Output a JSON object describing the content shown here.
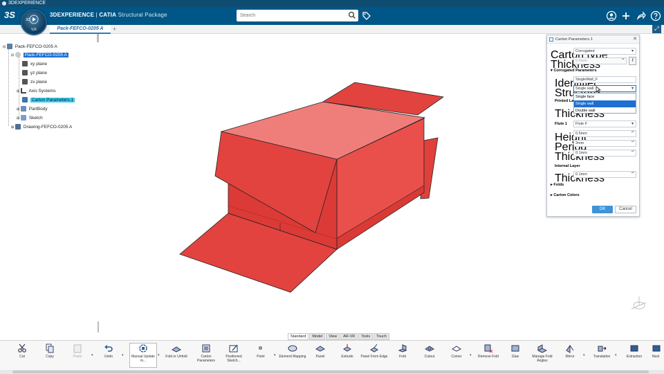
{
  "os": {
    "title": "3DEXPERIENCE"
  },
  "header": {
    "brand": "3DEXPERIENCE",
    "app": "CATIA",
    "app_sub": "Structural Package",
    "compass_version": "V,R",
    "search_placeholder": "Search",
    "accent": "#005686"
  },
  "tabs": {
    "document": "Pack-FEFCO-0205 A",
    "add": "+"
  },
  "tree": {
    "root": "Pack-FEFCO-0205 A",
    "product": "Pack-FEFCO-0205 A",
    "items": [
      "xy plane",
      "yz plane",
      "zx plane",
      "Axis Systems",
      "Carton Parameters.1",
      "PartBody",
      "Sketch"
    ],
    "drawing": "Drawing-FEFCO-0205 A"
  },
  "dialog": {
    "title": "Carton Parameters.1",
    "carton_type_label": "Carton type",
    "carton_type_value": "Corrugated",
    "thickness_label": "Thickness",
    "thickness_value": "0.4mm",
    "corrugated_section": "Corrugated Parameters",
    "identifier_label": "Identifier",
    "identifier_value": "SingleWall_F",
    "structure_label": "Structure",
    "structure_value": "Single wall",
    "structure_options": [
      "Single face",
      "Single wall",
      "Double wall"
    ],
    "printed_label": "Printed La",
    "printed_thickness_label": "Thickness",
    "flute_label": "Flute 1",
    "flute_value": "Flute F",
    "height_label": "Height",
    "height_value": "0.5mm",
    "period_label": "Period",
    "period_value": "2mm",
    "flute_thickness_label": "Thickness",
    "flute_thickness_value": "0.1mm",
    "internal_section": "Internal Layer",
    "internal_thickness_label": "Thickness",
    "internal_thickness_value": "0.1mm",
    "folds_section": "Folds",
    "colors_section": "Carton Colors",
    "ok": "OK",
    "cancel": "Cancel"
  },
  "section_tabs": [
    "Standard",
    "Model",
    "View",
    "AR-VR",
    "Tools",
    "Touch"
  ],
  "toolbar": [
    {
      "label": "Cut",
      "icon": "scissors-icon"
    },
    {
      "label": "Copy",
      "icon": "copy-icon"
    },
    {
      "label": "Paste",
      "icon": "paste-icon"
    },
    {
      "label": "Undo",
      "icon": "undo-icon"
    },
    {
      "label": "Manual Update m...",
      "icon": "update-icon"
    },
    {
      "label": "Fold or Unfold",
      "icon": "fold-unfold-icon"
    },
    {
      "label": "Carton Parameters",
      "icon": "carton-parameters-icon"
    },
    {
      "label": "Positioned Sketch...",
      "icon": "positioned-sketch-icon"
    },
    {
      "label": "Point",
      "icon": "point-icon"
    },
    {
      "label": "Element Mapping",
      "icon": "element-mapping-icon"
    },
    {
      "label": "Panel",
      "icon": "panel-icon"
    },
    {
      "label": "Extrude",
      "icon": "extrude-icon"
    },
    {
      "label": "Panel From Edge",
      "icon": "panel-from-edge-icon"
    },
    {
      "label": "Fold",
      "icon": "fold-icon"
    },
    {
      "label": "Cutout",
      "icon": "cutout-icon"
    },
    {
      "label": "Corner",
      "icon": "corner-icon"
    },
    {
      "label": "Remove Fold",
      "icon": "remove-fold-icon"
    },
    {
      "label": "Glue",
      "icon": "glue-icon"
    },
    {
      "label": "Manage Fold Angles",
      "icon": "manage-fold-angles-icon"
    },
    {
      "label": "Mirror",
      "icon": "mirror-icon"
    },
    {
      "label": "Translation",
      "icon": "translation-icon"
    },
    {
      "label": "Extraction",
      "icon": "extraction-icon"
    },
    {
      "label": "Nest",
      "icon": "nest-icon"
    }
  ],
  "colors": {
    "carton": "#e2433f",
    "carton_light": "#ef7e7a",
    "selection": "#1d6fd1",
    "highlight": "#3ad0ea"
  }
}
